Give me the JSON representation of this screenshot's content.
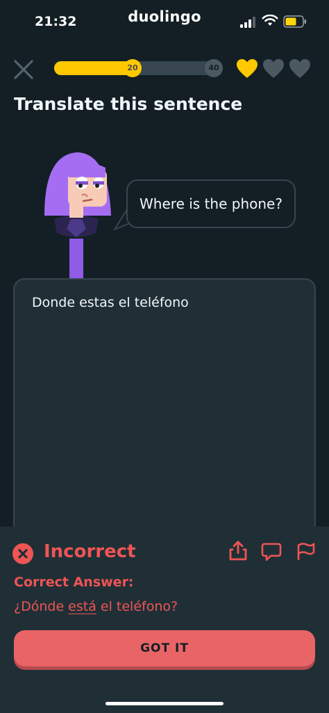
{
  "status_bar": {
    "time": "21:32",
    "app_name": "duolingo",
    "icons": [
      "signal-icon",
      "wifi-icon",
      "battery-icon"
    ]
  },
  "header": {
    "progress": {
      "current_label": "20",
      "goal_label": "40",
      "fill_fraction": 0.47
    },
    "hearts": [
      {
        "state": "filled",
        "color": "#FFC800"
      },
      {
        "state": "empty",
        "color": "#4B5A62"
      },
      {
        "state": "empty",
        "color": "#4B5A62"
      }
    ]
  },
  "exercise": {
    "title": "Translate this sentence",
    "prompt": "Where is the phone?",
    "user_answer": "Donde estas el teléfono"
  },
  "feedback": {
    "status": "Incorrect",
    "correct_heading": "Correct Answer:",
    "correct_answer_before": "¿Dónde ",
    "correct_answer_highlight": "está",
    "correct_answer_after": " el teléfono?",
    "button_label": "GOT IT",
    "actions": [
      "share-icon",
      "comment-icon",
      "flag-icon"
    ]
  },
  "colors": {
    "background": "#131F24",
    "surface": "#202F36",
    "accent_yellow": "#FFC800",
    "error_red": "#EE5555",
    "button_red": "#E96466"
  }
}
